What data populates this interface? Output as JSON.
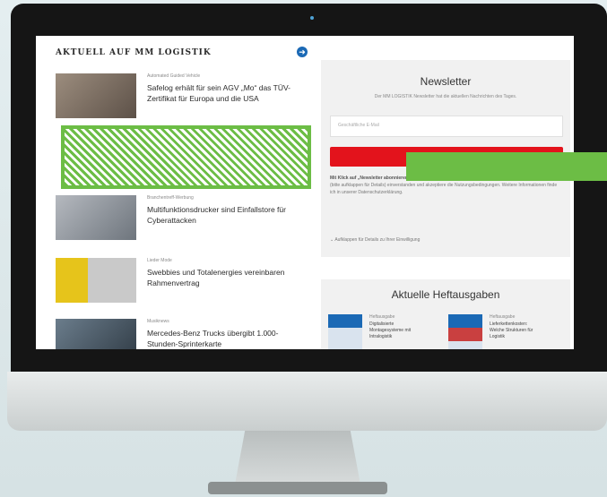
{
  "section": {
    "title": "AKTUELL AUF MM LOGISTIK"
  },
  "articles": [
    {
      "kicker": "Automated Guided Vehicle",
      "headline": "Safelog erhält für sein AGV „Mo“ das TÜV-Zertifikat für Europa und die USA",
      "thumb_color": "#7b6a5c"
    },
    {
      "kicker": "Branchentreff-Werbung",
      "headline": "Multifunktionsdrucker sind Einfallstore für Cyberattacken",
      "thumb_color": "#8a9099"
    },
    {
      "kicker": "Lieder Mode",
      "headline": "Swebbies und Totalenergies vereinbaren Rahmenvertrag",
      "thumb_color": "#e6c41b"
    },
    {
      "kicker": "Musiknews",
      "headline": "Mercedes-Benz Trucks übergibt 1.000-Stunden-Sprinterkarte",
      "thumb_color": "#4a5a68"
    }
  ],
  "newsletter": {
    "title": "Newsletter",
    "subtitle": "Der MM LOGISTIK Newsletter hat die aktuellen Nachrichten des Tages.",
    "email_placeholder": "Geschäftliche E-Mail",
    "button_label": "",
    "consent_bold": "Mit Klick auf „Newsletter abonnieren“",
    "consent_text": "Verarbeitung und Nutzung meiner Daten gemäß Einwilligungserklärung (bitte aufklappen für Details) einverstanden und akzeptiere die Nutzungsbedingungen. Weitere Informationen finde ich in unserer Datenschutzerklärung.",
    "toggle_label": "Aufklappen für Details zu Ihrer Einwilligung"
  },
  "issues": {
    "title": "Aktuelle Heftausgaben",
    "items": [
      {
        "kicker": "Heftausgabe",
        "title": "Digitalisierte Montagesysteme mit Intralogistik"
      },
      {
        "kicker": "Heftausgabe",
        "title": "Lieferkettenkosten: Welche Strukturen für Logistik"
      }
    ]
  },
  "colors": {
    "accent": "#e3131c",
    "brand_blue": "#1b69b5",
    "highlight": "#6cbd45"
  }
}
